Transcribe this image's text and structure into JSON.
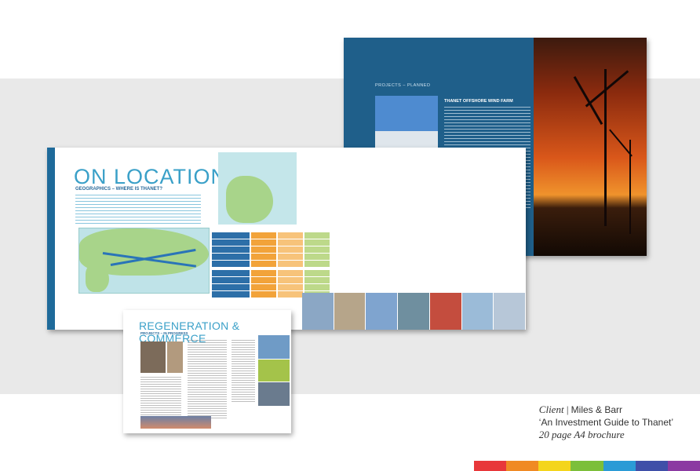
{
  "caption": {
    "client_label": "Client",
    "separator": "|",
    "client_name": "Miles & Barr",
    "project_title": "‘An Investment Guide to Thanet’",
    "format": "20 page A4 brochure"
  },
  "brochure_location": {
    "title": "ON LOCATION",
    "subheading": "GEOGRAPHICS – WHERE IS THANET?"
  },
  "brochure_wind": {
    "section_label": "PROJECTS – PLANNED",
    "heading": "THANET OFFSHORE WIND FARM"
  },
  "brochure_regen": {
    "title": "REGENERATION & COMMERCE",
    "subheading": "PROJECTS – IN PROGRESS"
  },
  "colors": {
    "rainbow": [
      "#e8373a",
      "#f08a24",
      "#f4d51c",
      "#7cbf3a",
      "#2b9bd6",
      "#3f4fa8",
      "#8b3aa2"
    ]
  }
}
